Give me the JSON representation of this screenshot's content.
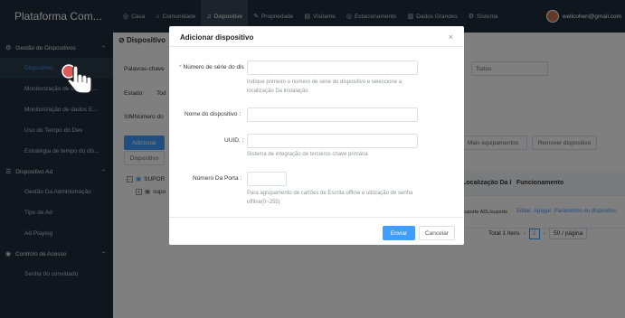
{
  "topbar": {
    "brand": "Plataforma Com...",
    "nav": [
      {
        "icon": "grid-icon",
        "glyph": "◎",
        "label": "Casa"
      },
      {
        "icon": "community-icon",
        "glyph": "⌂",
        "label": "Comunidade"
      },
      {
        "icon": "device-icon",
        "glyph": "♫",
        "label": "Dispositive"
      },
      {
        "icon": "property-icon",
        "glyph": "✎",
        "label": "Propriedade"
      },
      {
        "icon": "visitor-icon",
        "glyph": "▤",
        "label": "Visitante"
      },
      {
        "icon": "parking-icon",
        "glyph": "◎",
        "label": "Estacionamento"
      },
      {
        "icon": "bigdata-icon",
        "glyph": "▥",
        "label": "Dados Grandes"
      },
      {
        "icon": "system-icon",
        "glyph": "⚙",
        "label": "Sistema"
      }
    ],
    "user_email": "wellcohen@gmail.com"
  },
  "sidebar": {
    "groups": [
      {
        "label": "Gestão de Dispositivos",
        "items": [
          "Dispositivo",
          "Monitorização de dados E...",
          "Monitorização de dados E...",
          "Uso do Tempo do Dev",
          "Estratégia de tempo do dis..."
        ]
      },
      {
        "label": "Dispositivo Ad",
        "items": [
          "Gestão Da Administração",
          "Tipo de Ad",
          "Ad Playlog"
        ]
      },
      {
        "label": "Controlo de Acesso",
        "items": [
          "Senha do convidado"
        ]
      }
    ]
  },
  "main": {
    "crumb": "Dispositivo",
    "keyword_label": "Palavras-chave",
    "status_label": "Estado:",
    "status_value": "Tod",
    "sim_label": "SIMNúmero do",
    "add_button": "Adicionar",
    "secondary_button": "Dispositivo",
    "type_select": "Todos",
    "btn_right1": "Mais equipamentos",
    "btn_right2": "Remover dispositivo",
    "tree": [
      "SUPOR",
      "supo"
    ],
    "table_headers": [
      "Localização Da Ins",
      "Funcionamento"
    ],
    "table_row": {
      "location": "suporte ADL/suporte",
      "edit": "Editar",
      "delete": "Apagar",
      "params": "Parâmetros do dispositivo"
    },
    "pager_total": "Total 1 itens",
    "pager_page": "1",
    "pager_size": "50 / página"
  },
  "dialog": {
    "title": "Adicionar dispositivo",
    "close": "×",
    "serial_label": "Número de série do dis",
    "serial_hint": "Indique primeiro o número de série do dispositivo e seleccione a localização Da instalação",
    "name_label": "Nome do dispositivo :",
    "uuid_label": "UUID. :",
    "uuid_hint": "Sistema de integração de terceiros chave primária",
    "port_label": "Número Da Porta :",
    "port_hint": "Para agrupamento de cartões de Escrita offline e utilização de senha offline(0~255)",
    "submit": "Enviar",
    "cancel": "Cancelar"
  },
  "colors": {
    "primary": "#409eff",
    "sidebar": "#1f2d3d",
    "required": "#f56c6c"
  }
}
